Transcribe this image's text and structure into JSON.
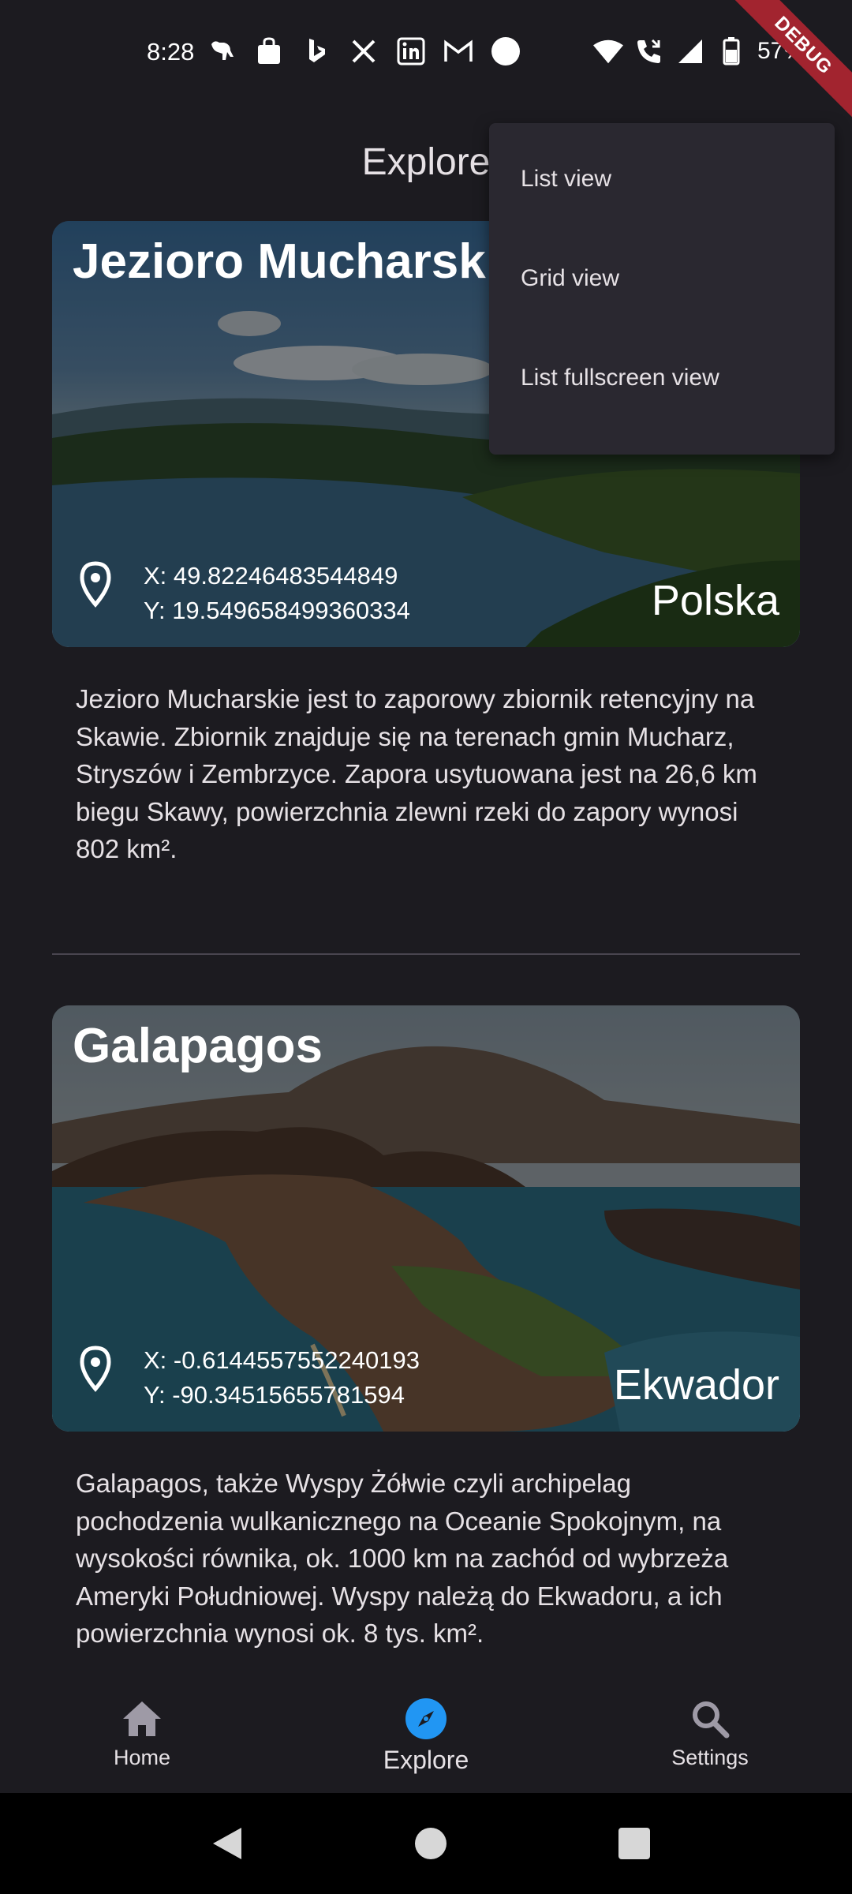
{
  "status_bar": {
    "time": "8:28",
    "battery": "57%",
    "left_icons": [
      "kangaroo-icon",
      "bag-icon",
      "bing-icon",
      "x-icon",
      "linkedin-icon",
      "gmail-icon",
      "circle-icon"
    ],
    "right_icons": [
      "wifi-icon",
      "call-icon",
      "signal-icon",
      "battery-icon"
    ]
  },
  "debug_banner": "DEBUG",
  "app_bar": {
    "title": "Explore"
  },
  "popup_menu": {
    "items": [
      {
        "label": "List view"
      },
      {
        "label": "Grid view"
      },
      {
        "label": "List fullscreen view"
      }
    ]
  },
  "places": [
    {
      "title": "Jezioro Mucharskie",
      "coord_x": "X: 49.82246483544849",
      "coord_y": "Y: 19.549658499360334",
      "country": "Polska",
      "description": "Jezioro Mucharskie jest to zaporowy zbiornik retencyjny na Skawie. Zbiornik znajduje się na terenach gmin Mucharz, Stryszów i Zembrzyce. Zapora usytuowana jest na 26,6 km biegu Skawy, powierzchnia zlewni rzeki do zapory wynosi 802 km²."
    },
    {
      "title": "Galapagos",
      "coord_x": "X: -0.6144557552240193",
      "coord_y": "Y: -90.34515655781594",
      "country": "Ekwador",
      "description": "Galapagos, także Wyspy Żółwie czyli archipelag pochodzenia wulkanicznego na Oceanie Spokojnym, na wysokości równika, ok. 1000 km na zachód od wybrzeża Ameryki Południowej. Wyspy należą do Ekwadoru, a ich powierzchnia wynosi ok. 8 tys. km²."
    }
  ],
  "bottom_nav": {
    "items": [
      {
        "label": "Home",
        "icon": "home-icon"
      },
      {
        "label": "Explore",
        "icon": "explore-icon"
      },
      {
        "label": "Settings",
        "icon": "search-icon"
      }
    ],
    "active_color": "#2196f3"
  },
  "system_nav": [
    "back-icon",
    "home-circle-icon",
    "recents-icon"
  ]
}
